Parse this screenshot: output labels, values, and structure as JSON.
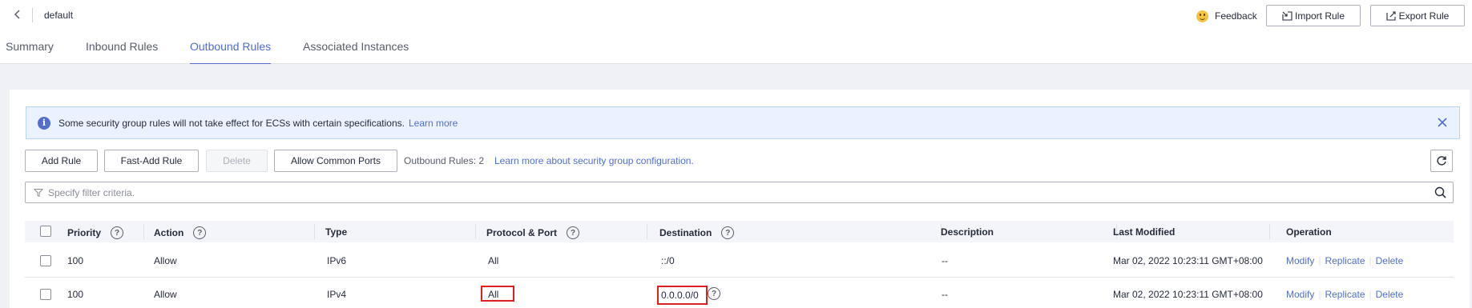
{
  "header": {
    "title": "default",
    "feedback_label": "Feedback",
    "import_label": "Import Rule",
    "export_label": "Export Rule"
  },
  "tabs": [
    {
      "label": "Summary",
      "active": false
    },
    {
      "label": "Inbound Rules",
      "active": false
    },
    {
      "label": "Outbound Rules",
      "active": true
    },
    {
      "label": "Associated Instances",
      "active": false
    }
  ],
  "alert": {
    "text": "Some security group rules will not take effect for ECSs with certain specifications.",
    "link": "Learn more"
  },
  "toolbar": {
    "add_rule": "Add Rule",
    "fast_add_rule": "Fast-Add Rule",
    "delete": "Delete",
    "allow_common_ports": "Allow Common Ports",
    "rule_count": "Outbound Rules: 2",
    "learn_more": "Learn more about security group configuration."
  },
  "search": {
    "placeholder": "Specify filter criteria."
  },
  "table": {
    "columns": [
      "Priority",
      "Action",
      "Type",
      "Protocol & Port",
      "Destination",
      "Description",
      "Last Modified",
      "Operation"
    ],
    "operations": [
      "Modify",
      "Replicate",
      "Delete"
    ],
    "rows": [
      {
        "priority": "100",
        "action": "Allow",
        "type": "IPv6",
        "protocol_port": "All",
        "destination": "::/0",
        "description": "--",
        "last_modified": "Mar 02, 2022 10:23:11 GMT+08:00",
        "highlighted": false
      },
      {
        "priority": "100",
        "action": "Allow",
        "type": "IPv4",
        "protocol_port": "All",
        "destination": "0.0.0.0/0",
        "description": "--",
        "last_modified": "Mar 02, 2022 10:23:11 GMT+08:00",
        "highlighted": true
      }
    ]
  },
  "colors": {
    "accent": "#526ecc",
    "highlight_box": "#e02020",
    "alert_bg": "#eaf3fd"
  }
}
